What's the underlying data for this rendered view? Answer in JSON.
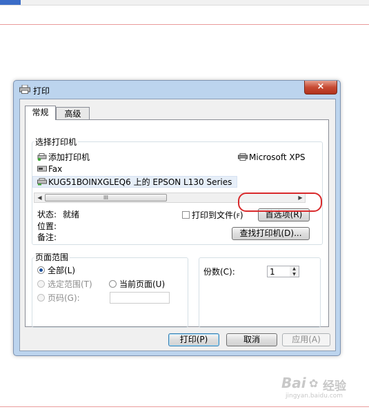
{
  "dialog": {
    "title": "打印",
    "close_label": "×"
  },
  "tabs": [
    {
      "label": "常规",
      "active": true
    },
    {
      "label": "高级",
      "active": false
    }
  ],
  "select_printer": {
    "group_label": "选择打印机",
    "printers": [
      {
        "name": "添加打印机",
        "icon": "add-printer-icon"
      },
      {
        "name": "Microsoft XPS",
        "icon": "printer-icon"
      },
      {
        "name": "Fax",
        "icon": "fax-icon"
      },
      {
        "name": "KUG51BOINXGLEQ6 上的 EPSON L130 Series",
        "icon": "network-printer-icon",
        "selected": true
      }
    ],
    "scroll_left": "◀",
    "scroll_right": "▶",
    "scroll_thumb_grip": "III",
    "status_label": "状态:",
    "status_value": "就绪",
    "location_label": "位置:",
    "comment_label": "备注:",
    "print_to_file_label": "打印到文件(",
    "print_to_file_key": "F",
    "print_to_file_close": ")",
    "preferences_button": "首选项(R)",
    "find_printer_button": "查找打印机(D)..."
  },
  "page_range": {
    "group_label": "页面范围",
    "all_label": "全部(L)",
    "selection_label": "选定范围(T)",
    "current_page_label": "当前页面(U)",
    "pages_label": "页码(G):",
    "pages_value": ""
  },
  "copies": {
    "label": "份数(C):",
    "value": "1"
  },
  "buttons": {
    "print": "打印(P)",
    "cancel": "取消",
    "apply": "应用(A)"
  },
  "watermark": {
    "brand": "Bai",
    "brand_suffix": "经验",
    "url": "jingyan.baidu.com"
  },
  "colors": {
    "annotation": "#d9292b",
    "selection_bg": "#e6eef8",
    "title_bg": "#bcd4ee"
  }
}
